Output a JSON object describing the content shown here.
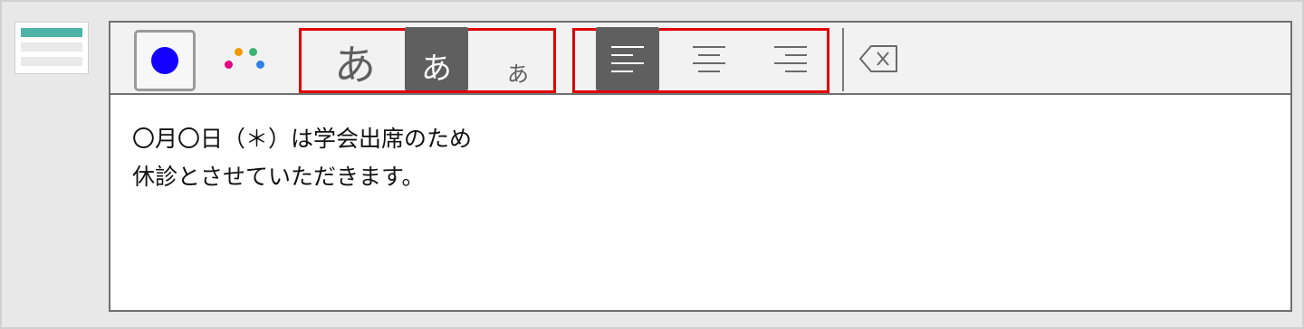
{
  "thumbnail": {
    "icon": "layout-thumbnail-icon",
    "colors": [
      "#4fb3a9",
      "#e9e9e9",
      "#e9e9e9"
    ]
  },
  "toolbar": {
    "color_button": {
      "icon": "color-swatch-icon",
      "color": "#1300ff"
    },
    "palette_button": {
      "icon": "palette-dots-icon",
      "colors": [
        "#f39800",
        "#3cb371",
        "#e4007f",
        "#2f80ed"
      ]
    },
    "text_size": {
      "options": [
        {
          "label": "あ",
          "size": "large",
          "active": false
        },
        {
          "label": "あ",
          "size": "medium",
          "active": true
        },
        {
          "label": "あ",
          "size": "small",
          "active": false
        }
      ],
      "highlight_color": "#e00000"
    },
    "alignment": {
      "options": [
        {
          "icon": "align-left-icon",
          "active": true
        },
        {
          "icon": "align-center-icon",
          "active": false
        },
        {
          "icon": "align-right-icon",
          "active": false
        }
      ],
      "highlight_color": "#e00000"
    },
    "backspace_button": {
      "icon": "backspace-icon"
    }
  },
  "content": {
    "lines": [
      "〇月〇日（＊）は学会出席のため",
      "休診とさせていただきます。"
    ]
  }
}
